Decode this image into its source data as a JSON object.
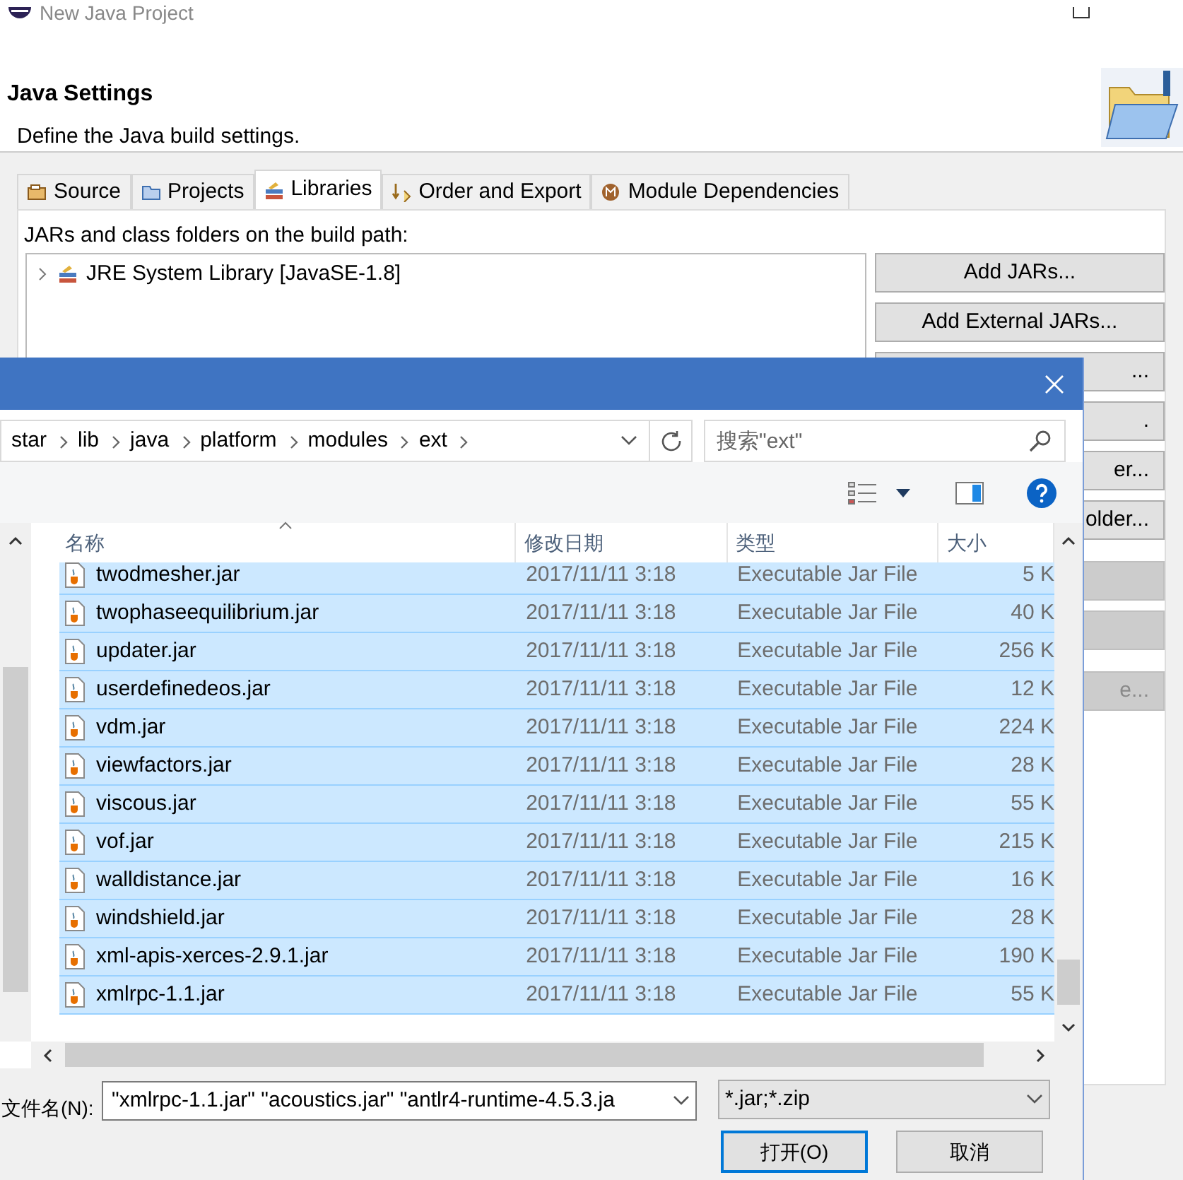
{
  "window": {
    "title": "New Java Project"
  },
  "header": {
    "title": "Java Settings",
    "description": "Define the Java build settings."
  },
  "tabs": [
    {
      "label": "Source",
      "selected": false
    },
    {
      "label": "Projects",
      "selected": false
    },
    {
      "label": "Libraries",
      "selected": true
    },
    {
      "label": "Order and Export",
      "selected": false
    },
    {
      "label": "Module Dependencies",
      "selected": false
    }
  ],
  "libraries": {
    "label": "JARs and class folders on the build path:",
    "tree": [
      {
        "label": "JRE System Library [JavaSE-1.8]",
        "expanded": false
      }
    ]
  },
  "side_buttons": [
    {
      "label": "Add JARs...",
      "disabled": false
    },
    {
      "label": "Add External JARs...",
      "disabled": false
    },
    {
      "label": "...",
      "disabled": false
    },
    {
      "label": ".",
      "disabled": false
    },
    {
      "label": "er...",
      "disabled": false
    },
    {
      "label": "older...",
      "disabled": false
    },
    {
      "disabled": true
    },
    {
      "disabled": true
    },
    {
      "label": "e...",
      "disabled": true
    }
  ],
  "file_dialog": {
    "path": [
      "star",
      "lib",
      "java",
      "platform",
      "modules",
      "ext"
    ],
    "search": {
      "placeholder": "搜索\"ext\""
    },
    "columns": [
      "名称",
      "修改日期",
      "类型",
      "大小"
    ],
    "rows": [
      {
        "name": "twodmesher.jar",
        "modified": "2017/11/11 3:18",
        "type": "Executable Jar File",
        "size": "5 K",
        "selected": true
      },
      {
        "name": "twophaseequilibrium.jar",
        "modified": "2017/11/11 3:18",
        "type": "Executable Jar File",
        "size": "40 K",
        "selected": true
      },
      {
        "name": "updater.jar",
        "modified": "2017/11/11 3:18",
        "type": "Executable Jar File",
        "size": "256 K",
        "selected": true
      },
      {
        "name": "userdefinedeos.jar",
        "modified": "2017/11/11 3:18",
        "type": "Executable Jar File",
        "size": "12 K",
        "selected": true
      },
      {
        "name": "vdm.jar",
        "modified": "2017/11/11 3:18",
        "type": "Executable Jar File",
        "size": "224 K",
        "selected": true
      },
      {
        "name": "viewfactors.jar",
        "modified": "2017/11/11 3:18",
        "type": "Executable Jar File",
        "size": "28 K",
        "selected": true
      },
      {
        "name": "viscous.jar",
        "modified": "2017/11/11 3:18",
        "type": "Executable Jar File",
        "size": "55 K",
        "selected": true
      },
      {
        "name": "vof.jar",
        "modified": "2017/11/11 3:18",
        "type": "Executable Jar File",
        "size": "215 K",
        "selected": true
      },
      {
        "name": "walldistance.jar",
        "modified": "2017/11/11 3:18",
        "type": "Executable Jar File",
        "size": "16 K",
        "selected": true
      },
      {
        "name": "windshield.jar",
        "modified": "2017/11/11 3:18",
        "type": "Executable Jar File",
        "size": "28 K",
        "selected": true
      },
      {
        "name": "xml-apis-xerces-2.9.1.jar",
        "modified": "2017/11/11 3:18",
        "type": "Executable Jar File",
        "size": "190 K",
        "selected": true
      },
      {
        "name": "xmlrpc-1.1.jar",
        "modified": "2017/11/11 3:18",
        "type": "Executable Jar File",
        "size": "55 K",
        "selected": true
      }
    ],
    "file_name": {
      "label": "文件名(N):",
      "value": "\"xmlrpc-1.1.jar\" \"acoustics.jar\" \"antlr4-runtime-4.5.3.ja"
    },
    "file_type": "*.jar;*.zip",
    "buttons": [
      {
        "label": "打开(O)",
        "default": true
      },
      {
        "label": "取消",
        "default": false
      }
    ]
  }
}
